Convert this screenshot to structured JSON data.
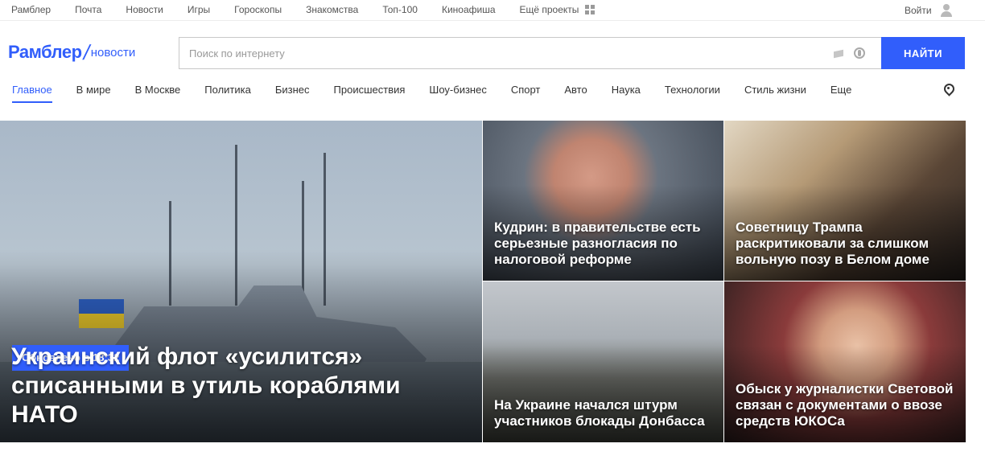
{
  "topbar": {
    "links": [
      "Рамблер",
      "Почта",
      "Новости",
      "Игры",
      "Гороскопы",
      "Знакомства",
      "Топ-100",
      "Киноафиша"
    ],
    "more_label": "Ещё проекты",
    "login_label": "Войти"
  },
  "header": {
    "brand": "Рамблер",
    "section": "новости"
  },
  "search": {
    "placeholder": "Поиск по интернету",
    "value": "",
    "button_label": "НАЙТИ"
  },
  "nav": {
    "items": [
      "Главное",
      "В мире",
      "В Москве",
      "Политика",
      "Бизнес",
      "Происшествия",
      "Шоу-бизнес",
      "Спорт",
      "Авто",
      "Наука",
      "Технологии",
      "Стиль жизни",
      "Еще"
    ],
    "active": "Главное"
  },
  "news": {
    "main": {
      "badge": "Обновлено в 18:32",
      "title": "Украинский флот «усилится» списанными в утиль кораблями НАТО"
    },
    "tiles": [
      {
        "title": "Кудрин: в правительстве есть серьезные разногласия по налоговой реформе"
      },
      {
        "title": "Советницу Трампа раскритиковали за слишком вольную позу в Белом доме"
      },
      {
        "title": "На Украине начался штурм участников блокады Донбасса"
      },
      {
        "title": "Обыск у журналистки Световой связан с документами о ввозе средств ЮКОСа"
      }
    ]
  },
  "colors": {
    "accent": "#315efb",
    "text": "#333333"
  }
}
